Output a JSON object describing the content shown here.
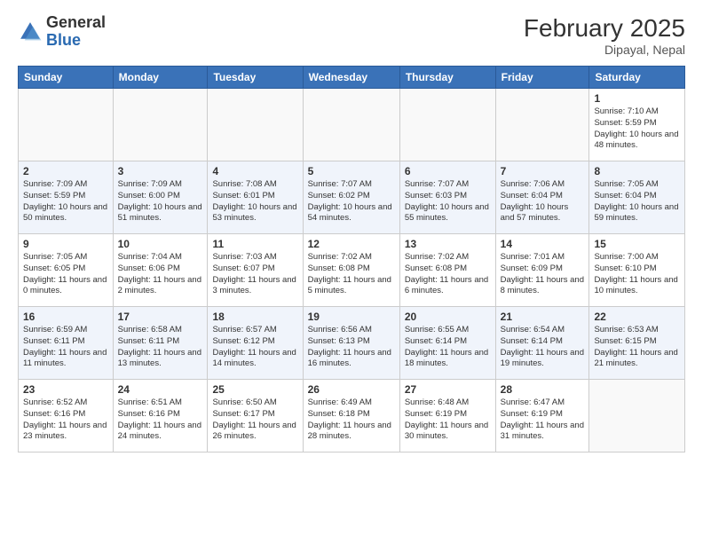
{
  "logo": {
    "general": "General",
    "blue": "Blue"
  },
  "header": {
    "month_year": "February 2025",
    "location": "Dipayal, Nepal"
  },
  "days_of_week": [
    "Sunday",
    "Monday",
    "Tuesday",
    "Wednesday",
    "Thursday",
    "Friday",
    "Saturday"
  ],
  "weeks": [
    [
      {
        "day": "",
        "empty": true
      },
      {
        "day": "",
        "empty": true
      },
      {
        "day": "",
        "empty": true
      },
      {
        "day": "",
        "empty": true
      },
      {
        "day": "",
        "empty": true
      },
      {
        "day": "",
        "empty": true
      },
      {
        "day": "1",
        "sunrise": "7:10 AM",
        "sunset": "5:59 PM",
        "daylight": "10 hours and 48 minutes."
      }
    ],
    [
      {
        "day": "2",
        "sunrise": "7:09 AM",
        "sunset": "5:59 PM",
        "daylight": "10 hours and 50 minutes."
      },
      {
        "day": "3",
        "sunrise": "7:09 AM",
        "sunset": "6:00 PM",
        "daylight": "10 hours and 51 minutes."
      },
      {
        "day": "4",
        "sunrise": "7:08 AM",
        "sunset": "6:01 PM",
        "daylight": "10 hours and 53 minutes."
      },
      {
        "day": "5",
        "sunrise": "7:07 AM",
        "sunset": "6:02 PM",
        "daylight": "10 hours and 54 minutes."
      },
      {
        "day": "6",
        "sunrise": "7:07 AM",
        "sunset": "6:03 PM",
        "daylight": "10 hours and 55 minutes."
      },
      {
        "day": "7",
        "sunrise": "7:06 AM",
        "sunset": "6:04 PM",
        "daylight": "10 hours and 57 minutes."
      },
      {
        "day": "8",
        "sunrise": "7:05 AM",
        "sunset": "6:04 PM",
        "daylight": "10 hours and 59 minutes."
      }
    ],
    [
      {
        "day": "9",
        "sunrise": "7:05 AM",
        "sunset": "6:05 PM",
        "daylight": "11 hours and 0 minutes."
      },
      {
        "day": "10",
        "sunrise": "7:04 AM",
        "sunset": "6:06 PM",
        "daylight": "11 hours and 2 minutes."
      },
      {
        "day": "11",
        "sunrise": "7:03 AM",
        "sunset": "6:07 PM",
        "daylight": "11 hours and 3 minutes."
      },
      {
        "day": "12",
        "sunrise": "7:02 AM",
        "sunset": "6:08 PM",
        "daylight": "11 hours and 5 minutes."
      },
      {
        "day": "13",
        "sunrise": "7:02 AM",
        "sunset": "6:08 PM",
        "daylight": "11 hours and 6 minutes."
      },
      {
        "day": "14",
        "sunrise": "7:01 AM",
        "sunset": "6:09 PM",
        "daylight": "11 hours and 8 minutes."
      },
      {
        "day": "15",
        "sunrise": "7:00 AM",
        "sunset": "6:10 PM",
        "daylight": "11 hours and 10 minutes."
      }
    ],
    [
      {
        "day": "16",
        "sunrise": "6:59 AM",
        "sunset": "6:11 PM",
        "daylight": "11 hours and 11 minutes."
      },
      {
        "day": "17",
        "sunrise": "6:58 AM",
        "sunset": "6:11 PM",
        "daylight": "11 hours and 13 minutes."
      },
      {
        "day": "18",
        "sunrise": "6:57 AM",
        "sunset": "6:12 PM",
        "daylight": "11 hours and 14 minutes."
      },
      {
        "day": "19",
        "sunrise": "6:56 AM",
        "sunset": "6:13 PM",
        "daylight": "11 hours and 16 minutes."
      },
      {
        "day": "20",
        "sunrise": "6:55 AM",
        "sunset": "6:14 PM",
        "daylight": "11 hours and 18 minutes."
      },
      {
        "day": "21",
        "sunrise": "6:54 AM",
        "sunset": "6:14 PM",
        "daylight": "11 hours and 19 minutes."
      },
      {
        "day": "22",
        "sunrise": "6:53 AM",
        "sunset": "6:15 PM",
        "daylight": "11 hours and 21 minutes."
      }
    ],
    [
      {
        "day": "23",
        "sunrise": "6:52 AM",
        "sunset": "6:16 PM",
        "daylight": "11 hours and 23 minutes."
      },
      {
        "day": "24",
        "sunrise": "6:51 AM",
        "sunset": "6:16 PM",
        "daylight": "11 hours and 24 minutes."
      },
      {
        "day": "25",
        "sunrise": "6:50 AM",
        "sunset": "6:17 PM",
        "daylight": "11 hours and 26 minutes."
      },
      {
        "day": "26",
        "sunrise": "6:49 AM",
        "sunset": "6:18 PM",
        "daylight": "11 hours and 28 minutes."
      },
      {
        "day": "27",
        "sunrise": "6:48 AM",
        "sunset": "6:19 PM",
        "daylight": "11 hours and 30 minutes."
      },
      {
        "day": "28",
        "sunrise": "6:47 AM",
        "sunset": "6:19 PM",
        "daylight": "11 hours and 31 minutes."
      },
      {
        "day": "",
        "empty": true
      }
    ]
  ]
}
